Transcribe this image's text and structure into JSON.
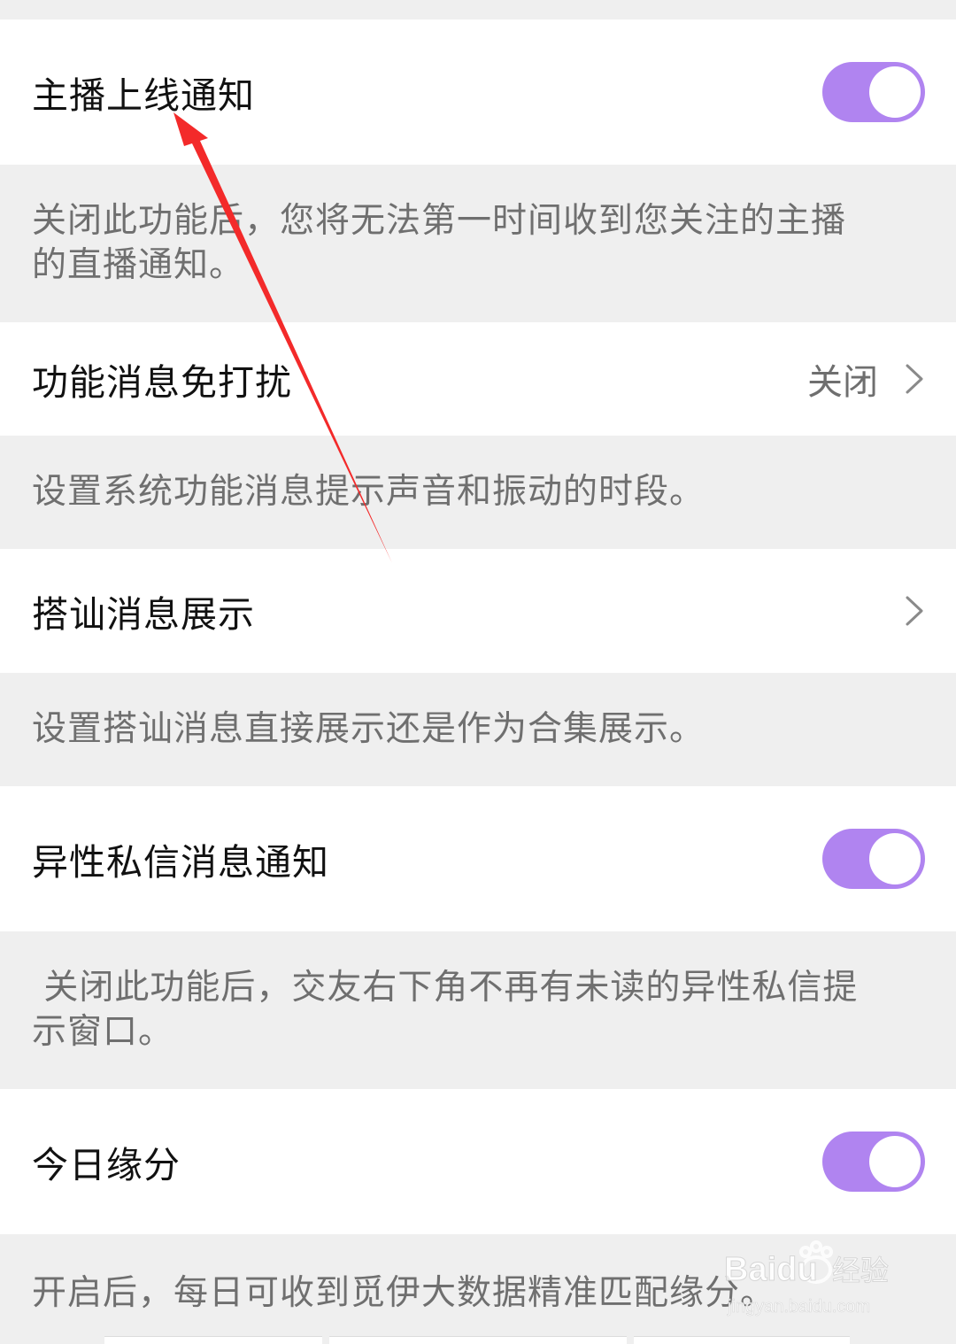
{
  "settings": {
    "anchor_online": {
      "label": "主播上线通知",
      "enabled": true,
      "desc_line1": "关闭此功能后，您将无法第一时间收到您关注的主播",
      "desc_line2": "的直播通知。"
    },
    "dnd": {
      "label": "功能消息免打扰",
      "value": "关闭",
      "desc": "设置系统功能消息提示声音和振动的时段。"
    },
    "greeting_display": {
      "label": "搭讪消息展示",
      "desc": "设置搭讪消息直接展示还是作为合集展示。"
    },
    "opposite_sex_dm": {
      "label": "异性私信消息通知",
      "enabled": true,
      "desc_line1": " 关闭此功能后，交友右下角不再有未读的异性私信提",
      "desc_line2": "示窗口。"
    },
    "daily_match": {
      "label": "今日缘分",
      "enabled": true,
      "desc": "开启后，每日可收到觅伊大数据精准匹配缘分。"
    }
  },
  "icons": {
    "chevron": "chevron-right-icon",
    "annotation": "red-arrow"
  },
  "watermark": {
    "brand": "Baidu",
    "suffix": "经验",
    "url": "jingyan.baidu.com"
  },
  "colors": {
    "accent": "#b084f0",
    "annotation": "#f32a2a",
    "background": "#efefef",
    "row": "#ffffff"
  }
}
